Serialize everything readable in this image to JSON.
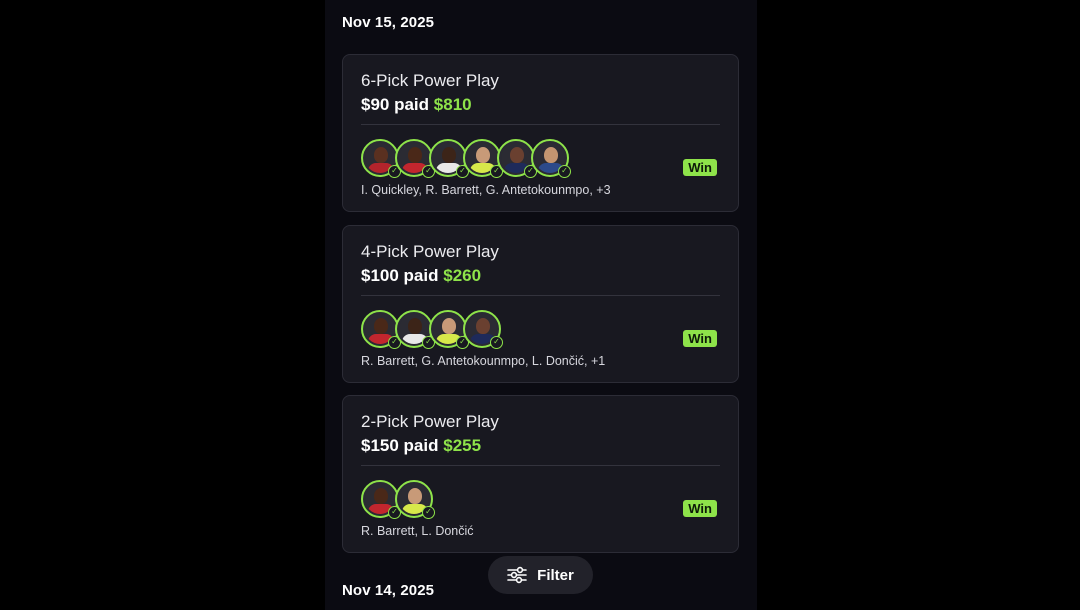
{
  "dates": {
    "first": "Nov 15, 2025",
    "second": "Nov 14, 2025"
  },
  "entries": [
    {
      "title": "6-Pick Power Play",
      "paid": "$90 paid",
      "won": "$810",
      "players": "I. Quickley, R. Barrett, G. Antetokounmpo, +3",
      "result": "Win",
      "avatars": [
        {
          "skin": "#5a3020",
          "jersey": "#b3242c"
        },
        {
          "skin": "#4a2818",
          "jersey": "#c2262e"
        },
        {
          "skin": "#3c2418",
          "jersey": "#e8e8e8"
        },
        {
          "skin": "#c89a78",
          "jersey": "#d7e84a"
        },
        {
          "skin": "#6a4030",
          "jersey": "#1e2a5a"
        },
        {
          "skin": "#c49570",
          "jersey": "#2c4a8a"
        }
      ]
    },
    {
      "title": "4-Pick Power Play",
      "paid": "$100 paid",
      "won": "$260",
      "players": "R. Barrett, G. Antetokounmpo, L. Dončić, +1",
      "result": "Win",
      "avatars": [
        {
          "skin": "#4a2818",
          "jersey": "#c2262e"
        },
        {
          "skin": "#3c2418",
          "jersey": "#e8e8e8"
        },
        {
          "skin": "#c89a78",
          "jersey": "#d7e84a"
        },
        {
          "skin": "#6a4030",
          "jersey": "#1e2a5a"
        }
      ]
    },
    {
      "title": "2-Pick Power Play",
      "paid": "$150 paid",
      "won": "$255",
      "players": "R. Barrett, L. Dončić",
      "result": "Win",
      "avatars": [
        {
          "skin": "#4a2818",
          "jersey": "#c2262e"
        },
        {
          "skin": "#c89a78",
          "jersey": "#d7e84a"
        }
      ]
    }
  ],
  "filter": {
    "label": "Filter",
    "icon": "sliders-icon"
  },
  "colors": {
    "accent": "#8ee34a",
    "card": "#181820",
    "background": "#0b0b12"
  }
}
